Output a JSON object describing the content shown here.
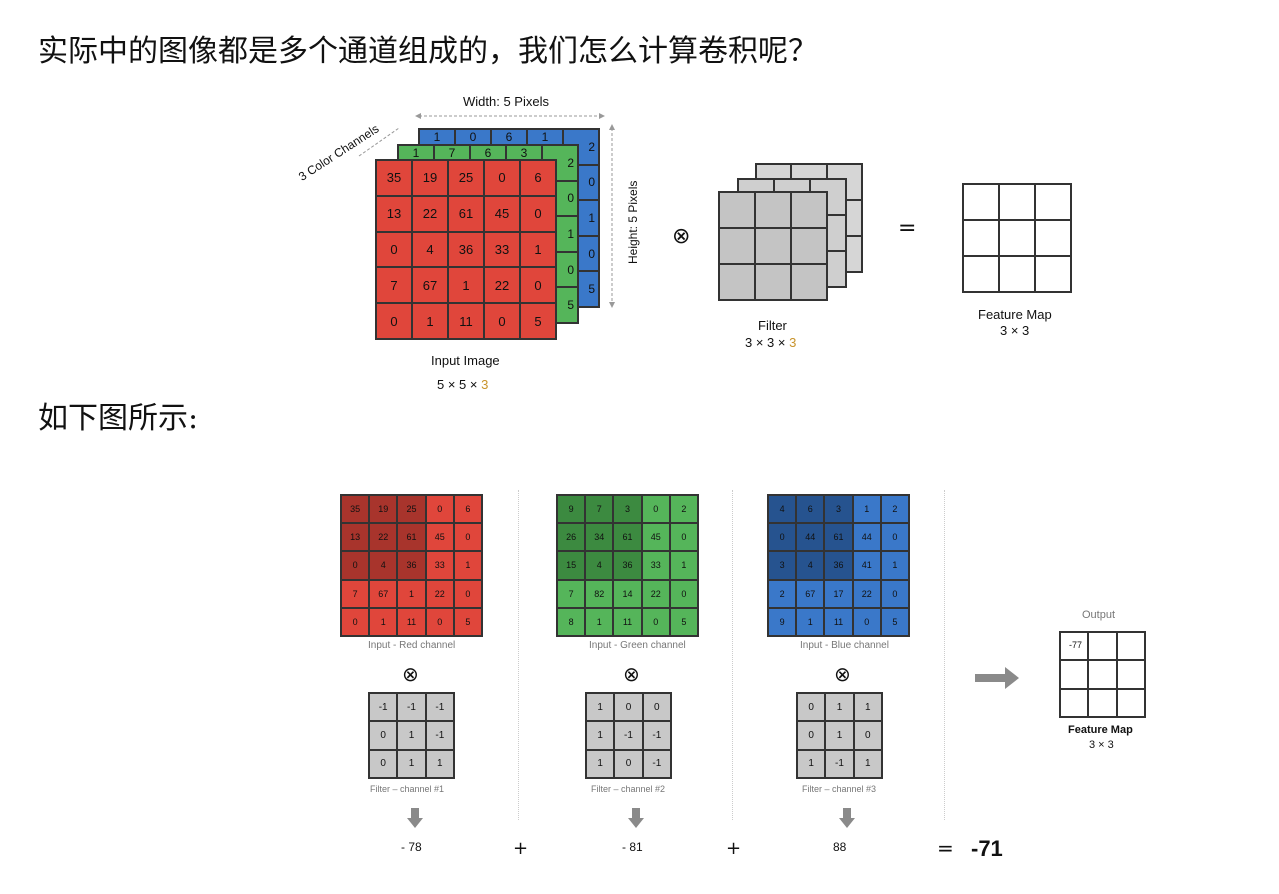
{
  "heading_top": "实际中的图像都是多个通道组成的，我们怎么计算卷积呢？",
  "heading_bottom": "如下图所示:",
  "figure1": {
    "width_label": "Width: 5 Pixels",
    "height_label": "Height: 5 Pixels",
    "channels_label": "3 Color Channels",
    "input_label": "Input Image",
    "input_dims_prefix": "5 × 5 × ",
    "input_dims_accent": "3",
    "filter_label": "Filter",
    "filter_dims_prefix": "3 × 3 × ",
    "filter_dims_accent": "3",
    "feature_label": "Feature Map",
    "feature_dims": "3 × 3",
    "conv_symbol": "⊗",
    "equals_symbol": "=",
    "red_matrix": [
      [
        "35",
        "19",
        "25",
        "0",
        "6"
      ],
      [
        "13",
        "22",
        "61",
        "45",
        "0"
      ],
      [
        "0",
        "4",
        "36",
        "33",
        "1"
      ],
      [
        "7",
        "67",
        "1",
        "22",
        "0"
      ],
      [
        "0",
        "1",
        "11",
        "0",
        "5"
      ]
    ],
    "green_edge": [
      "2",
      "0",
      "1",
      "0",
      "5"
    ],
    "blue_edge": [
      "2",
      "0",
      "1",
      "0",
      "5"
    ],
    "green_top": [
      "1",
      "7",
      "6",
      "3"
    ],
    "blue_top": [
      "1",
      "0",
      "6",
      "1"
    ]
  },
  "figure2": {
    "channels": [
      {
        "matrix": [
          [
            "35",
            "19",
            "25",
            "0",
            "6"
          ],
          [
            "13",
            "22",
            "61",
            "45",
            "0"
          ],
          [
            "0",
            "4",
            "36",
            "33",
            "1"
          ],
          [
            "7",
            "67",
            "1",
            "22",
            "0"
          ],
          [
            "0",
            "1",
            "11",
            "0",
            "5"
          ]
        ],
        "caption": "Input - Red channel",
        "filter": [
          [
            "-1",
            "-1",
            "-1"
          ],
          [
            "0",
            "1",
            "-1"
          ],
          [
            "0",
            "1",
            "1"
          ]
        ],
        "filter_caption": "Filter – channel #1",
        "result": "- 78"
      },
      {
        "matrix": [
          [
            "9",
            "7",
            "3",
            "0",
            "2"
          ],
          [
            "26",
            "34",
            "61",
            "45",
            "0"
          ],
          [
            "15",
            "4",
            "36",
            "33",
            "1"
          ],
          [
            "7",
            "82",
            "14",
            "22",
            "0"
          ],
          [
            "8",
            "1",
            "11",
            "0",
            "5"
          ]
        ],
        "caption": "Input - Green channel",
        "filter": [
          [
            "1",
            "0",
            "0"
          ],
          [
            "1",
            "-1",
            "-1"
          ],
          [
            "1",
            "0",
            "-1"
          ]
        ],
        "filter_caption": "Filter – channel #2",
        "result": "- 81"
      },
      {
        "matrix": [
          [
            "4",
            "6",
            "3",
            "1",
            "2"
          ],
          [
            "0",
            "44",
            "61",
            "44",
            "0"
          ],
          [
            "3",
            "4",
            "36",
            "41",
            "1"
          ],
          [
            "2",
            "67",
            "17",
            "22",
            "0"
          ],
          [
            "9",
            "1",
            "11",
            "0",
            "5"
          ]
        ],
        "caption": "Input - Blue channel",
        "filter": [
          [
            "0",
            "1",
            "1"
          ],
          [
            "0",
            "1",
            "0"
          ],
          [
            "1",
            "-1",
            "1"
          ]
        ],
        "filter_caption": "Filter – channel #3",
        "result": "88"
      }
    ],
    "conv_symbol": "⊗",
    "plus_symbol": "+",
    "equals_symbol": "=",
    "total": "-71",
    "output_label": "Output",
    "output_value": "-77",
    "feature_label": "Feature Map",
    "feature_dims": "3 × 3"
  },
  "colors": {
    "red": "#e0463b",
    "red_dark": "#a8342c",
    "green": "#55b55a",
    "green_dark": "#3c8a40",
    "blue": "#3a78c9",
    "blue_dark": "#26538f",
    "accent": "#c8932b",
    "filter_gray": "#c8c8c8"
  }
}
